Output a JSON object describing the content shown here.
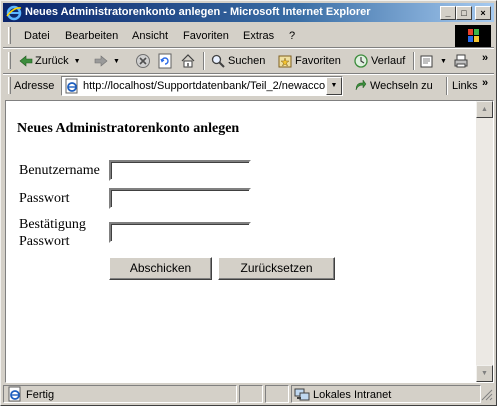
{
  "window": {
    "title": "Neues Administratorenkonto anlegen - Microsoft Internet Explorer",
    "controls": {
      "minimize": "_",
      "maximize": "□",
      "close": "×"
    }
  },
  "menu": {
    "items": [
      "Datei",
      "Bearbeiten",
      "Ansicht",
      "Favoriten",
      "Extras",
      "?"
    ]
  },
  "toolbar": {
    "back_label": "Zurück",
    "search_label": "Suchen",
    "favorites_label": "Favoriten",
    "history_label": "Verlauf",
    "overflow": "»"
  },
  "address": {
    "label": "Adresse",
    "url": "http://localhost/Supportdatenbank/Teil_2/newacco",
    "go_label": "Wechseln zu",
    "links_label": "Links",
    "overflow": "»"
  },
  "page": {
    "heading": "Neues Administratorenkonto anlegen",
    "fields": {
      "username_label": "Benutzername",
      "password_label": "Passwort",
      "confirm_label_line1": "Bestätigung",
      "confirm_label_line2": "Passwort"
    },
    "buttons": {
      "submit": "Abschicken",
      "reset": "Zurücksetzen"
    }
  },
  "status": {
    "text": "Fertig",
    "zone": "Lokales Intranet"
  },
  "colors": {
    "chrome": "#d4d0c8",
    "title_start": "#0a246a",
    "title_end": "#a6caf0",
    "accent_green": "#3c8c3c",
    "ie_blue": "#1e5fbf"
  }
}
